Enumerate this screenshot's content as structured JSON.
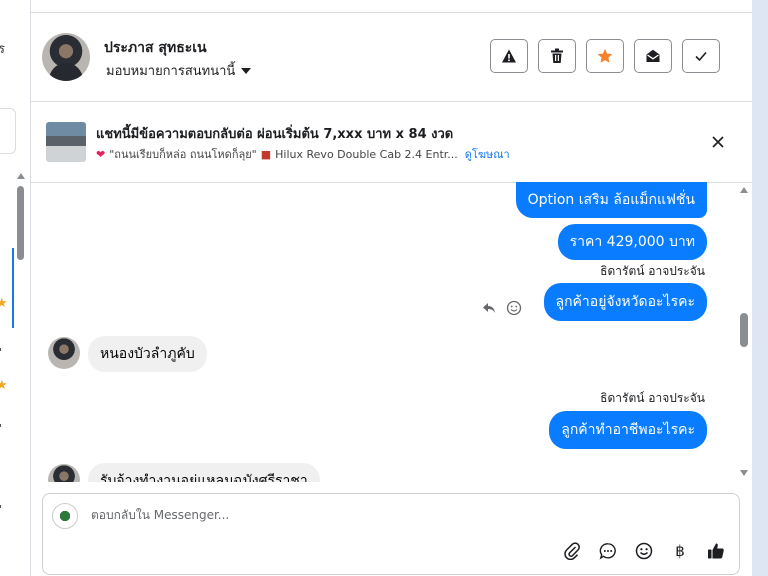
{
  "left_strip": {
    "text_fragment": "ร"
  },
  "header": {
    "contact_name": "ประภาส สุทธะเน",
    "assign_label": "มอบหมายการสนทนานี้",
    "actions": [
      {
        "name": "spam-button",
        "icon": "warning-icon"
      },
      {
        "name": "delete-button",
        "icon": "trash-icon"
      },
      {
        "name": "star-button",
        "icon": "star-icon",
        "color": "#f5822a"
      },
      {
        "name": "mark-unread-button",
        "icon": "envelope-open-icon"
      },
      {
        "name": "mark-done-button",
        "icon": "check-icon"
      }
    ]
  },
  "ad": {
    "title": "แชทนี้มีข้อความตอบกลับต่อ ผ่อนเริ่มต้น 7,xxx บาท x 84 งวด",
    "subtitle": "\"ถนนเรียบก็หล่อ ถนนโหดก็ลุย\"",
    "subtitle_model": "Hilux Revo Double Cab 2.4 Entr...",
    "link": "ดูโฆษณา"
  },
  "messages": {
    "m1": "Option เสริม ล้อแม็กแฟชั่น",
    "m2": "ราคา 429,000 บาท",
    "sender1": "ธิดารัตน์ อาจประจัน",
    "m3": "ลูกค้าอยู่จังหวัดอะไรคะ",
    "in1": "หนองบัวลำภูคับ",
    "sender2": "ธิดารัตน์ อาจประจัน",
    "m4": "ลูกค้าทำอาชีพอะไรคะ",
    "in2": "รับจ้างทำงานอยู่แหลมฉบังศรีราชา"
  },
  "composer": {
    "placeholder": "ตอบกลับใน Messenger...",
    "tools": [
      "attach-icon",
      "chat-bubble-icon",
      "emoji-icon",
      "baht-icon",
      "thumbs-up-icon"
    ],
    "baht_symbol": "฿"
  },
  "colors": {
    "accent": "#0a7cff",
    "star": "#f5822a",
    "link": "#1877f2"
  }
}
